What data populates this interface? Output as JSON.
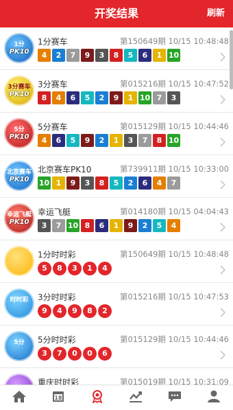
{
  "header": {
    "title": "开奖结果",
    "refresh": "刷新"
  },
  "colors": {
    "accent": "#e3262b",
    "pk10": [
      "#e6b400",
      "#1a7fd4",
      "#555555",
      "#e57f00",
      "#16b8c0",
      "#2c2c7e",
      "#9b9b9b",
      "#d32121",
      "#7d1a1a",
      "#28a428"
    ],
    "ball": "#e3262b"
  },
  "items": [
    {
      "name": "1分赛车",
      "issue": "第150649期",
      "time": "10/15 10:48:48",
      "icon": "pk10-1min-logo",
      "logo_text": "1分",
      "numbers": [
        "4",
        "2",
        "7",
        "9",
        "3",
        "8",
        "5",
        "6",
        "1",
        "10"
      ],
      "style": "pk10"
    },
    {
      "name": "3分赛车",
      "issue": "第015216期",
      "time": "10/15 10:47:52",
      "icon": "pk10-3min-logo",
      "logo_text": "3分赛车",
      "numbers": [
        "8",
        "4",
        "6",
        "5",
        "2",
        "9",
        "1",
        "10",
        "7",
        "3"
      ],
      "style": "pk10"
    },
    {
      "name": "5分赛车",
      "issue": "第015129期",
      "time": "10/15 10:44:46",
      "icon": "pk10-5min-logo",
      "logo_text": "5分",
      "numbers": [
        "4",
        "6",
        "5",
        "9",
        "2",
        "1",
        "3",
        "7",
        "8",
        "10"
      ],
      "style": "pk10"
    },
    {
      "name": "北京赛车PK10",
      "issue": "第739911期",
      "time": "10/15 10:33:00",
      "icon": "beijing-pk10-logo",
      "logo_text": "北京赛车",
      "numbers": [
        "10",
        "1",
        "9",
        "3",
        "8",
        "5",
        "2",
        "6",
        "4",
        "7"
      ],
      "style": "pk10"
    },
    {
      "name": "幸运飞艇",
      "issue": "第014180期",
      "time": "10/15 04:04:43",
      "icon": "lucky-airship-logo",
      "logo_text": "幸运飞艇",
      "numbers": [
        "3",
        "7",
        "10",
        "8",
        "6",
        "1",
        "9",
        "2",
        "5",
        "4"
      ],
      "style": "pk10"
    },
    {
      "name": "1分时时彩",
      "issue": "第150649期",
      "time": "10/15 10:48:48",
      "icon": "ssc-1min-logo",
      "logo_text": "",
      "numbers": [
        "5",
        "8",
        "3",
        "1",
        "4"
      ],
      "style": "ball"
    },
    {
      "name": "3分时时彩",
      "issue": "第015216期",
      "time": "10/15 10:47:53",
      "icon": "ssc-3min-logo",
      "logo_text": "时时彩",
      "numbers": [
        "9",
        "4",
        "9",
        "8",
        "2"
      ],
      "style": "ball"
    },
    {
      "name": "5分时时彩",
      "issue": "第015129期",
      "time": "10/15 10:44:46",
      "icon": "ssc-5min-logo",
      "logo_text": "5分",
      "numbers": [
        "3",
        "7",
        "0",
        "0",
        "6"
      ],
      "style": "ball"
    },
    {
      "name": "重庆时时彩",
      "issue": "第015019期",
      "time": "10/15 10:31:09",
      "icon": "chongqing-ssc-logo",
      "logo_text": "",
      "numbers": [],
      "style": "ball"
    }
  ],
  "tabs": [
    {
      "icon": "home-icon"
    },
    {
      "icon": "calendar-icon",
      "label": "18"
    },
    {
      "icon": "award-icon"
    },
    {
      "icon": "trend-chart-icon"
    },
    {
      "icon": "chat-icon"
    },
    {
      "icon": "user-icon"
    }
  ]
}
